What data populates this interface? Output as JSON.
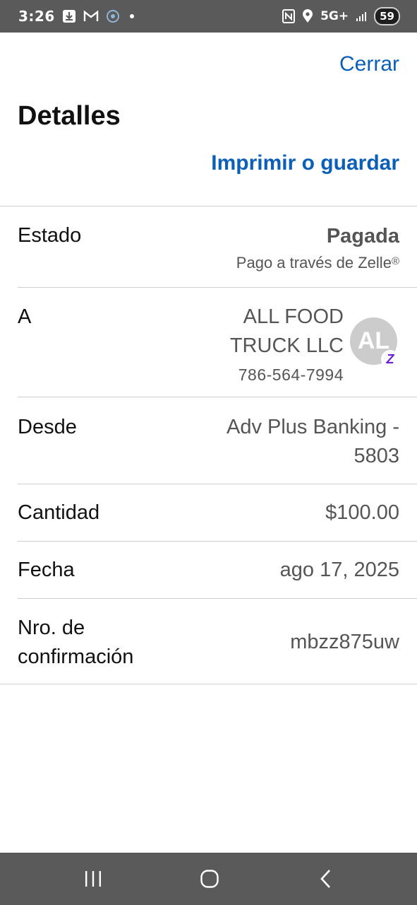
{
  "status_bar": {
    "time": "3:26",
    "network": "5G+",
    "battery": "59",
    "icons": [
      "download-icon",
      "gmail-icon",
      "sync-icon",
      "dot-icon",
      "nfc-icon",
      "location-icon",
      "signal-icon"
    ]
  },
  "header": {
    "close_label": "Cerrar",
    "title": "Detalles",
    "print_label": "Imprimir o guardar"
  },
  "details": {
    "status": {
      "label": "Estado",
      "value": "Pagada",
      "method": "Pago a través de Zelle",
      "method_mark": "®"
    },
    "recipient": {
      "label": "A",
      "name": "ALL FOOD TRUCK LLC",
      "phone": "786-564-7994",
      "avatar_initials": "AL",
      "badge": "Z"
    },
    "from": {
      "label": "Desde",
      "value": "Adv Plus Banking - 5803"
    },
    "amount": {
      "label": "Cantidad",
      "value": "$100.00"
    },
    "date": {
      "label": "Fecha",
      "value": "ago 17, 2025"
    },
    "confirmation": {
      "label": "Nro. de confirmación",
      "value": "mbzz875uw"
    }
  },
  "colors": {
    "link": "#0b5fb8",
    "value_text": "#555555",
    "system_bars": "#5a5a5a",
    "zelle_purple": "#6d1ed4"
  },
  "nav_bar": {
    "icons": [
      "recent-apps-icon",
      "home-icon",
      "back-icon"
    ]
  }
}
